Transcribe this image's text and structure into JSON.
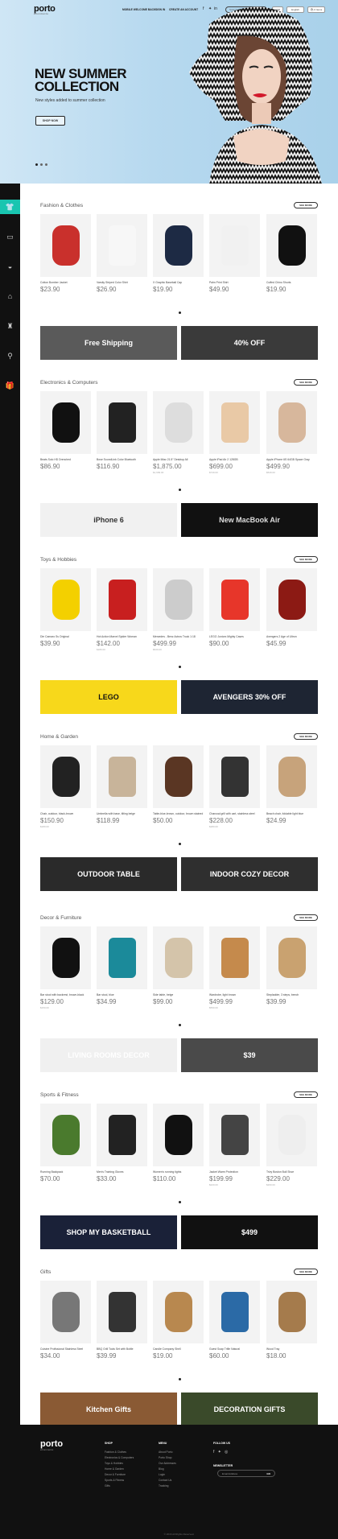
{
  "header": {
    "logo": "porto",
    "logo_sub": "eCommerce",
    "nav": [
      "Mobile Welcome Back",
      "Sign In",
      "Create an Account"
    ],
    "search_placeholder": "Search products...",
    "language": "USD",
    "language2": "English",
    "cart": "0 Items"
  },
  "hero": {
    "title": "NEW SUMMER COLLECTION",
    "subtitle": "New styles added to summer collection",
    "button": "SHOP NOW"
  },
  "sections": [
    {
      "title": "Fashion & Clothes",
      "see_more": "SEE MORE",
      "products": [
        {
          "name": "Cotton Bomber Jacket",
          "price": "$23.90",
          "old": ""
        },
        {
          "name": "Varsity Striped Color Shirt",
          "price": "$26.90",
          "old": ""
        },
        {
          "name": "X Graphic Baseball Cap",
          "price": "$19.90",
          "old": ""
        },
        {
          "name": "Palm Print Shirt",
          "price": "$49.90",
          "old": ""
        },
        {
          "name": "Cuffed Chino Shorts",
          "price": "$19.90",
          "old": ""
        }
      ],
      "banners": [
        "Free Shipping",
        "40% OFF"
      ]
    },
    {
      "title": "Electronics & Computers",
      "see_more": "SEE MORE",
      "products": [
        {
          "name": "Beats Solo HD Drenched",
          "price": "$86.90",
          "old": ""
        },
        {
          "name": "Bose SoundLink Color Bluetooth",
          "price": "$116.90",
          "old": ""
        },
        {
          "name": "Apple iMac 21.5\" Desktop All",
          "price": "$1,875.00",
          "old": "$1,999.00"
        },
        {
          "name": "Apple iPad Air 2 128GB",
          "price": "$699.00",
          "old": "$749.00"
        },
        {
          "name": "Apple iPhone 6S 64GB Space Gray",
          "price": "$499.90",
          "old": "$549.00"
        }
      ],
      "banners": [
        "iPhone 6",
        "New MacBook Air"
      ]
    },
    {
      "title": "Toys & Hobbies",
      "see_more": "SEE MORE",
      "products": [
        {
          "name": "Die Camaro Ss Original",
          "price": "$39.90",
          "old": ""
        },
        {
          "name": "Hot Action Marvel Spider Woman",
          "price": "$142.00",
          "old": "$180.00"
        },
        {
          "name": "Mercedes - Benz Actros Truck 1:18",
          "price": "$499.99",
          "old": "$529.00"
        },
        {
          "name": "LEGO Juniors Mighty Cases",
          "price": "$90.00",
          "old": ""
        },
        {
          "name": "Avengers 2 Age of Ultron",
          "price": "$45.99",
          "old": ""
        }
      ],
      "banners": [
        "LEGO",
        "AVENGERS 30% OFF"
      ]
    },
    {
      "title": "Home & Garden",
      "see_more": "SEE MORE",
      "products": [
        {
          "name": "Chair, outdoor, black-brown",
          "price": "$150.90",
          "old": "$180.00"
        },
        {
          "name": "Umbrella with base, tilting beige",
          "price": "$118.99",
          "old": ""
        },
        {
          "name": "Table-blue-brown, outdoor, brown stained",
          "price": "$50.00",
          "old": ""
        },
        {
          "name": "Charcoal grill with cart, stainless steel",
          "price": "$228.00",
          "old": "$280.00"
        },
        {
          "name": "Beach chair, foldable light blue",
          "price": "$24.99",
          "old": ""
        }
      ],
      "banners": [
        "OUTDOOR TABLE",
        "INDOOR COZY DECOR"
      ]
    },
    {
      "title": "Decor & Furniture",
      "see_more": "SEE MORE",
      "products": [
        {
          "name": "Bar stool with backrest, brown-black",
          "price": "$129.00",
          "old": "$150.00"
        },
        {
          "name": "Bar stool, blue",
          "price": "$34.99",
          "old": ""
        },
        {
          "name": "Side table, beige",
          "price": "$99.00",
          "old": ""
        },
        {
          "name": "Wardrobe, light brown",
          "price": "$499.99",
          "old": "$590.00"
        },
        {
          "name": "Stepladder, 3 steps, beech",
          "price": "$39.99",
          "old": ""
        }
      ],
      "banners": [
        "LIVING ROOMS DECOR",
        "$39"
      ]
    },
    {
      "title": "Sports & Fitness",
      "see_more": "SEE MORE",
      "products": [
        {
          "name": "Running Backpack",
          "price": "$70.00",
          "old": ""
        },
        {
          "name": "Men's Training Gloves",
          "price": "$33.00",
          "old": ""
        },
        {
          "name": "Women's running tights",
          "price": "$110.00",
          "old": ""
        },
        {
          "name": "Jacket Warm Protection",
          "price": "$199.99",
          "old": "$220.00"
        },
        {
          "name": "Trivy Boston Bull Shoe",
          "price": "$229.00",
          "old": "$260.00"
        }
      ],
      "banners": [
        "SHOP MY BASKETBALL",
        "$499"
      ]
    },
    {
      "title": "Gifts",
      "see_more": "SEE MORE",
      "products": [
        {
          "name": "Cuisine Profissional Stainless Steel",
          "price": "$34.00",
          "old": ""
        },
        {
          "name": "BBQ Grill Tools Set with Bottle",
          "price": "$39.99",
          "old": ""
        },
        {
          "name": "Candle Company Shell",
          "price": "$19.00",
          "old": ""
        },
        {
          "name": "Guest Soap Trifle Natural",
          "price": "$60.00",
          "old": ""
        },
        {
          "name": "Wood Tray",
          "price": "$18.00",
          "old": ""
        }
      ],
      "banners": [
        "Kitchen Gifts",
        "DECORATION GIFTS"
      ]
    }
  ],
  "footer": {
    "logo": "porto",
    "logo_sub": "eCommerce",
    "shop_title": "Shop",
    "shop_links": [
      "Fashion & Clothes",
      "Electronics & Computers",
      "Toys & Hobbies",
      "Home & Garden",
      "Decor & Furniture",
      "Sports & Fitness",
      "Gifts"
    ],
    "menu_title": "Menu",
    "menu_links": [
      "About Porto",
      "Porto Shop",
      "Our Addresses",
      "Blog",
      "Login",
      "Contact Us",
      "Tracking"
    ],
    "follow_title": "Follow Us",
    "newsletter_title": "Newsletter",
    "newsletter_placeholder": "Email Address",
    "newsletter_button": "GO",
    "copyright": "© 2016 All Rights Reserved."
  }
}
